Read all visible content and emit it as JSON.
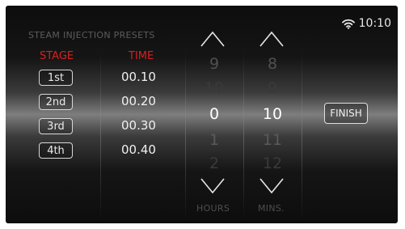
{
  "header": {
    "title": "STEAM INJECTION PRESETS",
    "time": "10:10",
    "wifi_icon": "wifi-icon"
  },
  "table": {
    "stage_header": "STAGE",
    "time_header": "TIME",
    "rows": [
      {
        "stage": "1st",
        "time": "00.10"
      },
      {
        "stage": "2nd",
        "time": "00.20"
      },
      {
        "stage": "3rd",
        "time": "00.30"
      },
      {
        "stage": "4th",
        "time": "00.40"
      }
    ]
  },
  "hours_picker": {
    "values": [
      "9",
      "10",
      "0",
      "1",
      "2"
    ],
    "label": "HOURS"
  },
  "mins_picker": {
    "values": [
      "8",
      "9",
      "10",
      "11",
      "12"
    ],
    "label": "MINS."
  },
  "finish_label": "FINISH",
  "colors": {
    "accent_red": "#d92020",
    "text": "#f0f0f0",
    "dim": "#505050"
  }
}
